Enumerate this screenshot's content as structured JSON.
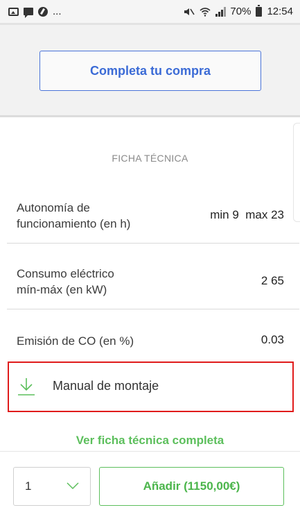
{
  "status_bar": {
    "dots": "...",
    "battery": "70%",
    "time": "12:54"
  },
  "cta": {
    "label": "Completa tu compra"
  },
  "sheet": {
    "title": "FICHA TÉCNICA",
    "rows": [
      {
        "label_line1": "Autonomía de",
        "label_line2": "funcionamiento (en h)",
        "value": "min 9  max 23"
      },
      {
        "label_line1": "Consumo eléctrico",
        "label_line2": "mín-máx (en kW)",
        "value": "2 65"
      },
      {
        "label_line1": "Emisión de CO (en %)",
        "label_line2": "",
        "value": "0.03"
      }
    ],
    "manual_label": "Manual de montaje",
    "full_sheet_link": "Ver ficha técnica completa"
  },
  "purchase": {
    "quantity": "1",
    "add_label": "Añadir (1150,00€)"
  },
  "colors": {
    "accent_blue": "#3b6bd6",
    "accent_green": "#5cbf5c",
    "highlight_red": "#e01b1b"
  }
}
